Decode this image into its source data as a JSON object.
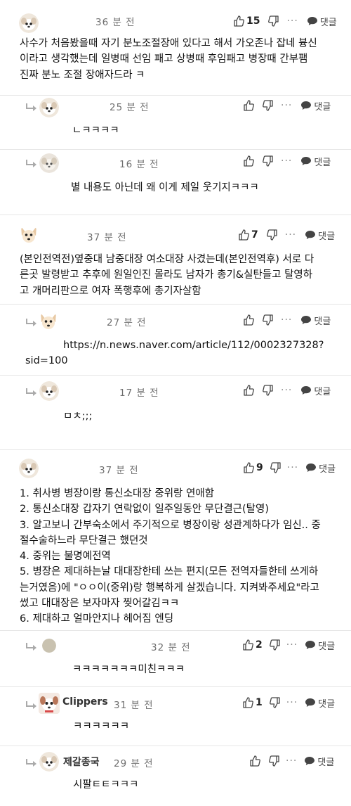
{
  "comments": [
    {
      "time": "36 분 전",
      "likes": "15",
      "text": "사수가 처음봤을때 자기 분노조절장애 있다고 해서 가오존나 잡네 븅신\n이라고 생각했는데 일병때 선임 패고 상병때 후임패고 병장때 간부팸\n진짜 분노 조절 장애자드라 ㅋ"
    },
    {
      "time": "25 분 전",
      "likes": "",
      "text": "ㄴㅋㅋㅋㅋ"
    },
    {
      "time": "16 분 전",
      "likes": "",
      "text": "별 내용도 아닌데 왜 이게 제일 웃기지ㅋㅋㅋ"
    },
    {
      "time": "37 분 전",
      "likes": "7",
      "text": "(본인전역전)옆중대 남중대장 여소대장 사겼는데(본인전역후) 서로 다\n른곳 발령받고 추후에 원일인진 몰라도 남자가 총기&실탄들고 탈영하\n고 개머리판으로 여자 폭행후에 총기자살함"
    },
    {
      "time": "27 분 전",
      "likes": "",
      "text": "https://n.news.naver.com/article/112/0002327328?\nsid=100"
    },
    {
      "time": "17 분 전",
      "likes": "",
      "text": "ㅁㅊ;;;"
    },
    {
      "time": "37 분 전",
      "likes": "9",
      "text": "1. 취사병 병장이랑 통신소대장 중위랑 연애함\n2. 통신소대장 갑자기 연락없이 일주일동안 무단결근(탈영)\n3. 알고보니 간부숙소에서 주기적으로 병장이랑 성관계하다가 임신.. 중\n절수술하느라 무단결근 했던것\n4. 중위는 불명예전역\n5. 병장은 제대하는날 대대장한테 쓰는 편지(모든 전역자들한테 쓰게하\n는거였음)에 \"ㅇㅇ이(중위)랑 행복하게 살겠습니다. 지켜봐주세요\"라고\n썼고 대대장은 보자마자 찢어갈김ㅋㅋ\n6. 제대하고 얼마안지나 헤어짐 엔딩"
    },
    {
      "time": "32 분 전",
      "likes": "2",
      "text": "ㅋㅋㅋㅋㅋㅋㅋ미친ㅋㅋㅋ"
    },
    {
      "author": "Clippers",
      "time": "31 분 전",
      "likes": "1",
      "text": "ㅋㅋㅋㅋㅋㅋ"
    },
    {
      "author": "제갈종국",
      "time": "29 분 전",
      "likes": "",
      "text": "시팔ㅌㅌㅋㅋㅋ"
    }
  ],
  "labels": {
    "dots": "···",
    "reply": "댓글"
  },
  "icons": {
    "like": "thumbs-up-icon",
    "dislike": "thumbs-down-icon",
    "reply": "speech-bubble-icon",
    "indent": "reply-arrow-icon"
  },
  "colors": {
    "text": "#111111",
    "muted": "#6f6f6f",
    "icon": "#555555",
    "separator": "#e6e6e6"
  }
}
